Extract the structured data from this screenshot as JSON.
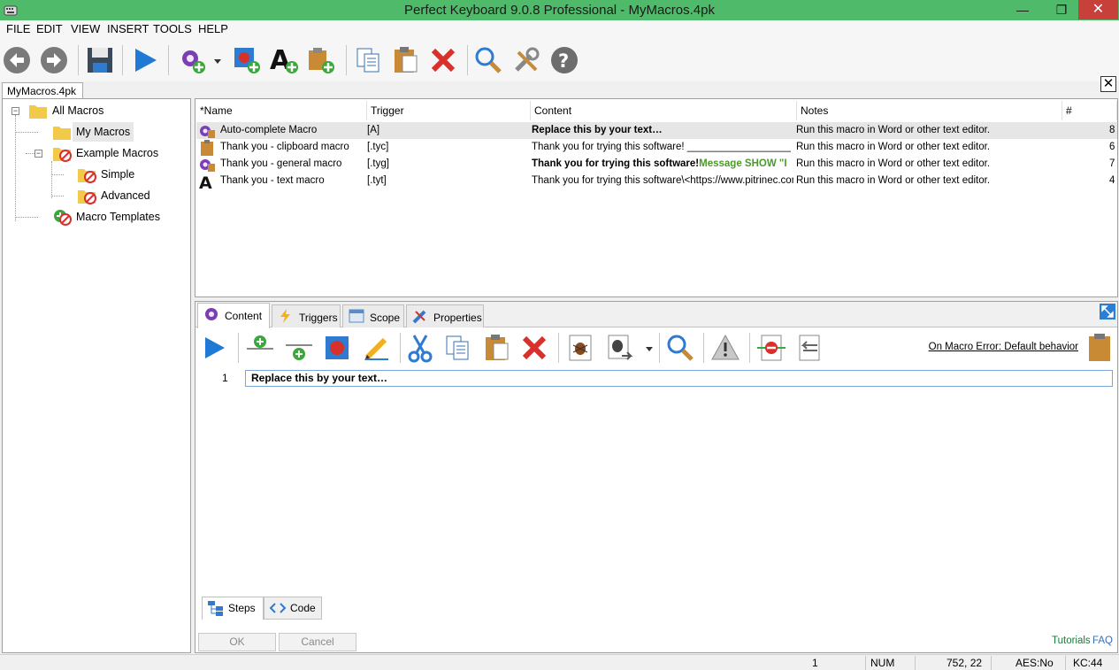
{
  "window": {
    "title": "Perfect Keyboard 9.0.8 Professional - MyMacros.4pk",
    "minimize": "—",
    "restore": "❐",
    "close": "✕"
  },
  "menu": [
    "FILE",
    "EDIT",
    "VIEW",
    "INSERT",
    "TOOLS",
    "HELP"
  ],
  "toolbar": {
    "icons": [
      "back-icon",
      "forward-icon",
      "save-icon",
      "run-icon",
      "new-macro-icon",
      "dropdown-arrow-icon",
      "new-recorded-macro-icon",
      "new-text-macro-icon",
      "new-clipboard-macro-icon",
      "copy-icon",
      "paste-icon",
      "delete-icon",
      "search-icon",
      "options-icon",
      "help-icon"
    ]
  },
  "document_tab": {
    "label": "MyMacros.4pk",
    "close": "✕"
  },
  "tree": {
    "items": [
      {
        "label": "All Macros",
        "icon": "folder-icon"
      },
      {
        "label": "My Macros",
        "icon": "folder-icon"
      },
      {
        "label": "Example Macros",
        "icon": "disabled-folder-icon"
      },
      {
        "label": "Simple",
        "icon": "disabled-folder-icon"
      },
      {
        "label": "Advanced",
        "icon": "disabled-folder-icon"
      },
      {
        "label": "Macro Templates",
        "icon": "disabled-template-icon"
      }
    ],
    "expander_minus": "−"
  },
  "list": {
    "columns": [
      "*Name",
      "Trigger",
      "Content",
      "Notes",
      "#"
    ],
    "rows": [
      {
        "icon": "general-macro-icon",
        "name": "Auto-complete Macro",
        "trigger": "[A]",
        "content": "Replace this by your text…",
        "content_extra": "",
        "notes": "Run this macro in Word or other text editor.",
        "count": "8"
      },
      {
        "icon": "clipboard-macro-icon",
        "name": "Thank you - clipboard macro",
        "trigger": "[.tyc]",
        "content": "Thank you for trying this software! ______________________",
        "content_extra": "",
        "notes": "Run this macro in Word or other text editor.",
        "count": "6"
      },
      {
        "icon": "general-macro-icon",
        "name": "Thank you - general macro",
        "trigger": "[.tyg]",
        "content": "Thank you for trying this software!",
        "content_extra": "Message SHOW \"I",
        "notes": "Run this macro in Word or other text editor.",
        "count": "7"
      },
      {
        "icon": "text-macro-icon",
        "name": "Thank you - text macro",
        "trigger": "[.tyt]",
        "content": "Thank you for trying this software\\<https://www.pitrinec.com...",
        "content_extra": "",
        "notes": "Run this macro in Word or other text editor.",
        "count": "4"
      }
    ]
  },
  "editor": {
    "tabs": [
      {
        "label": "Content",
        "icon": "gear-icon"
      },
      {
        "label": "Triggers",
        "icon": "lightning-icon"
      },
      {
        "label": "Scope",
        "icon": "window-icon"
      },
      {
        "label": "Properties",
        "icon": "properties-icon"
      }
    ],
    "toolbar_icons": [
      "run-icon",
      "insert-step-above-icon",
      "insert-step-below-icon",
      "record-icon",
      "edit-icon",
      "cut-icon",
      "copy-icon",
      "paste-icon",
      "delete-icon",
      "debug-icon",
      "debug-step-icon",
      "dropdown-arrow-icon",
      "find-icon",
      "warning-icon",
      "disable-step-icon",
      "undo-step-icon",
      "clipboard-icon"
    ],
    "on_error": "On Macro Error: Default behavior",
    "lines": [
      {
        "num": "1",
        "text": "Replace this by your text…"
      }
    ],
    "bottom_tabs": [
      {
        "label": "Steps",
        "icon": "steps-icon"
      },
      {
        "label": "Code",
        "icon": "code-icon"
      }
    ],
    "ok": "OK",
    "cancel": "Cancel",
    "tutorials": "Tutorials",
    "faq": "FAQ"
  },
  "status": {
    "line": "1",
    "num": "NUM",
    "position": "752,  22",
    "aes": "AES:No",
    "kc": "KC:44"
  },
  "colors": {
    "title_bar": "#4fbb6a",
    "accent_blue": "#1f7ad6",
    "delete_red": "#d8302a",
    "link_green": "#1a7a3a",
    "link_blue": "#3a6fb0"
  }
}
